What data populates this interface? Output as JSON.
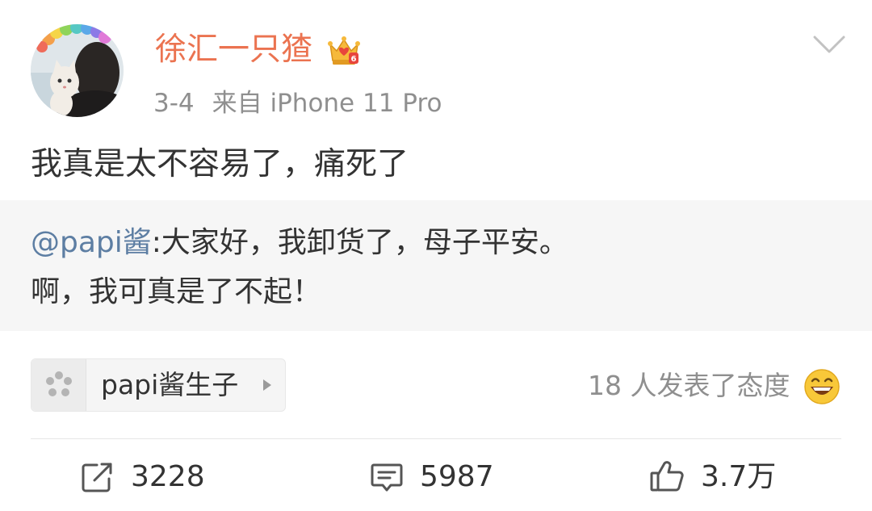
{
  "post": {
    "author": "徐汇一只猹",
    "time": "3-4",
    "source": "来自 iPhone 11 Pro",
    "text": "我真是太不容易了，痛死了",
    "badge_icon": "crown-badge-icon",
    "menu_icon": "chevron-down-icon"
  },
  "quote": {
    "mention": "@papi酱",
    "line1_rest": ":大家好，我卸货了，母子平安。",
    "line2": "啊，我可真是了不起！"
  },
  "topic": {
    "label": "papi酱生子",
    "icon": "super-topic-icon"
  },
  "reactions": {
    "text": "18 人发表了态度",
    "emoji_icon": "grinning-emoji-icon"
  },
  "actions": {
    "repost_count": "3228",
    "comment_count": "5987",
    "like_count": "3.7万"
  },
  "colors": {
    "username": "#eb7350",
    "mention": "#5d7ea3",
    "meta": "#8f8f8f",
    "quote_bg": "#f6f6f6"
  }
}
